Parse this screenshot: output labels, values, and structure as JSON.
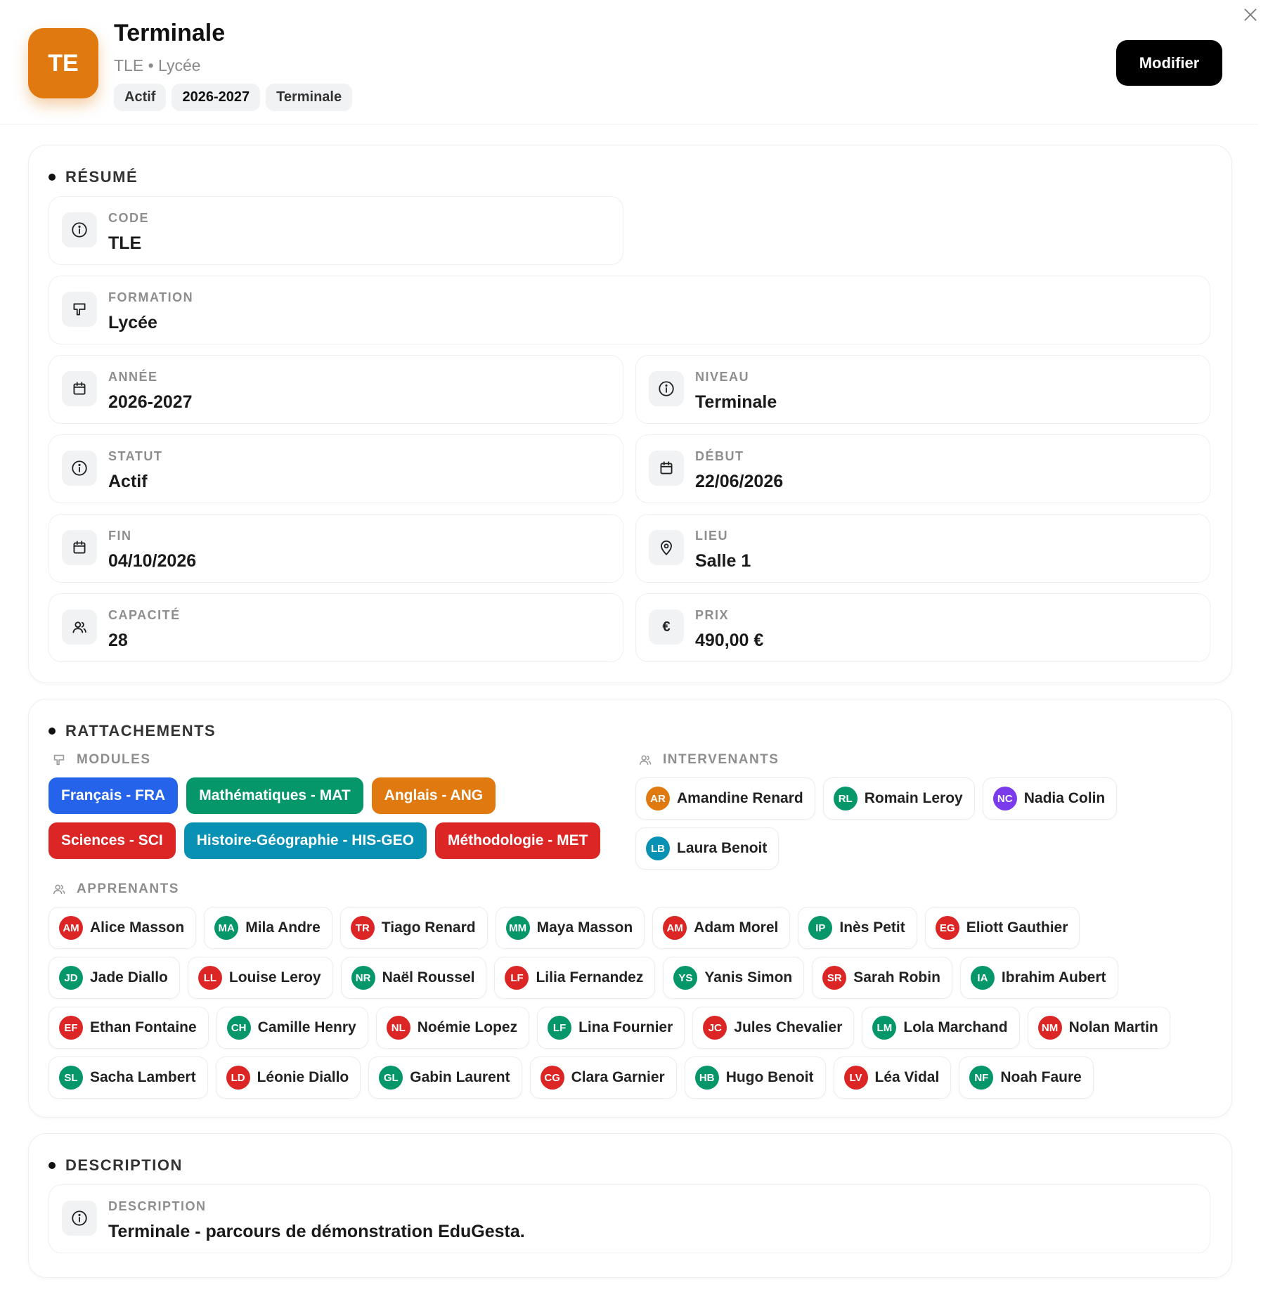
{
  "header": {
    "avatar": "TE",
    "title": "Terminale",
    "code": "TLE",
    "separator": "•",
    "formation": "Lycée",
    "tags": [
      "Actif",
      "2026-2027",
      "Terminale"
    ],
    "modify_label": "Modifier",
    "accent_color": "#e07a10"
  },
  "resume": {
    "title": "RÉSUMÉ",
    "fields": {
      "code": {
        "label": "CODE",
        "value": "TLE",
        "icon": "info-icon"
      },
      "formation": {
        "label": "FORMATION",
        "value": "Lycée",
        "icon": "book-icon"
      },
      "annee": {
        "label": "ANNÉE",
        "value": "2026-2027",
        "icon": "calendar-icon"
      },
      "niveau": {
        "label": "NIVEAU",
        "value": "Terminale",
        "icon": "info-icon"
      },
      "statut": {
        "label": "STATUT",
        "value": "Actif",
        "icon": "info-icon"
      },
      "debut": {
        "label": "DÉBUT",
        "value": "22/06/2026",
        "icon": "calendar-icon"
      },
      "fin": {
        "label": "FIN",
        "value": "04/10/2026",
        "icon": "calendar-icon"
      },
      "lieu": {
        "label": "LIEU",
        "value": "Salle 1",
        "icon": "map-pin-icon"
      },
      "capacite": {
        "label": "CAPACITÉ",
        "value": "28",
        "icon": "users-icon"
      },
      "prix": {
        "label": "PRIX",
        "value": "490,00 €",
        "icon": "euro-icon",
        "icon_glyph": "€"
      }
    }
  },
  "rattachements": {
    "title": "RATTACHEMENTS",
    "modules_label": "MODULES",
    "intervenants_label": "INTERVENANTS",
    "apprenants_label": "APPRENANTS",
    "modules": [
      {
        "label": "Français - FRA",
        "color": "#2563eb"
      },
      {
        "label": "Mathématiques - MAT",
        "color": "#059669"
      },
      {
        "label": "Anglais - ANG",
        "color": "#e07a10"
      },
      {
        "label": "Sciences - SCI",
        "color": "#dc2626"
      },
      {
        "label": "Histoire-Géographie - HIS-GEO",
        "color": "#0891b2"
      },
      {
        "label": "Méthodologie - MET",
        "color": "#dc2626"
      }
    ],
    "intervenants": [
      {
        "initials": "AR",
        "name": "Amandine Renard",
        "color": "#e07a10"
      },
      {
        "initials": "RL",
        "name": "Romain Leroy",
        "color": "#059669"
      },
      {
        "initials": "NC",
        "name": "Nadia Colin",
        "color": "#7c3aed"
      },
      {
        "initials": "LB",
        "name": "Laura Benoit",
        "color": "#0891b2"
      }
    ],
    "apprenants": [
      [
        {
          "initials": "AM",
          "name": "Alice Masson",
          "color": "#dc2626"
        },
        {
          "initials": "MA",
          "name": "Mila Andre",
          "color": "#059669"
        },
        {
          "initials": "TR",
          "name": "Tiago Renard",
          "color": "#dc2626"
        },
        {
          "initials": "MM",
          "name": "Maya Masson",
          "color": "#059669"
        },
        {
          "initials": "AM",
          "name": "Adam Morel",
          "color": "#dc2626"
        },
        {
          "initials": "IP",
          "name": "Inès Petit",
          "color": "#059669"
        },
        {
          "initials": "EG",
          "name": "Eliott Gauthier",
          "color": "#dc2626"
        }
      ],
      [
        {
          "initials": "JD",
          "name": "Jade Diallo",
          "color": "#059669"
        },
        {
          "initials": "LL",
          "name": "Louise Leroy",
          "color": "#dc2626"
        },
        {
          "initials": "NR",
          "name": "Naël Roussel",
          "color": "#059669"
        },
        {
          "initials": "LF",
          "name": "Lilia Fernandez",
          "color": "#dc2626"
        },
        {
          "initials": "YS",
          "name": "Yanis Simon",
          "color": "#059669"
        },
        {
          "initials": "SR",
          "name": "Sarah Robin",
          "color": "#dc2626"
        },
        {
          "initials": "IA",
          "name": "Ibrahim Aubert",
          "color": "#059669"
        }
      ],
      [
        {
          "initials": "EF",
          "name": "Ethan Fontaine",
          "color": "#dc2626"
        },
        {
          "initials": "CH",
          "name": "Camille Henry",
          "color": "#059669"
        },
        {
          "initials": "NL",
          "name": "Noémie Lopez",
          "color": "#dc2626"
        },
        {
          "initials": "LF",
          "name": "Lina Fournier",
          "color": "#059669"
        },
        {
          "initials": "JC",
          "name": "Jules Chevalier",
          "color": "#dc2626"
        },
        {
          "initials": "LM",
          "name": "Lola Marchand",
          "color": "#059669"
        },
        {
          "initials": "NM",
          "name": "Nolan Martin",
          "color": "#dc2626"
        }
      ],
      [
        {
          "initials": "SL",
          "name": "Sacha Lambert",
          "color": "#059669"
        },
        {
          "initials": "LD",
          "name": "Léonie Diallo",
          "color": "#dc2626"
        },
        {
          "initials": "GL",
          "name": "Gabin Laurent",
          "color": "#059669"
        },
        {
          "initials": "CG",
          "name": "Clara Garnier",
          "color": "#dc2626"
        },
        {
          "initials": "HB",
          "name": "Hugo Benoit",
          "color": "#059669"
        },
        {
          "initials": "LV",
          "name": "Léa Vidal",
          "color": "#dc2626"
        },
        {
          "initials": "NF",
          "name": "Noah Faure",
          "color": "#059669"
        }
      ]
    ]
  },
  "description": {
    "title": "DESCRIPTION",
    "field": {
      "label": "DESCRIPTION",
      "value": "Terminale - parcours de démonstration EduGesta.",
      "icon": "info-icon"
    }
  }
}
